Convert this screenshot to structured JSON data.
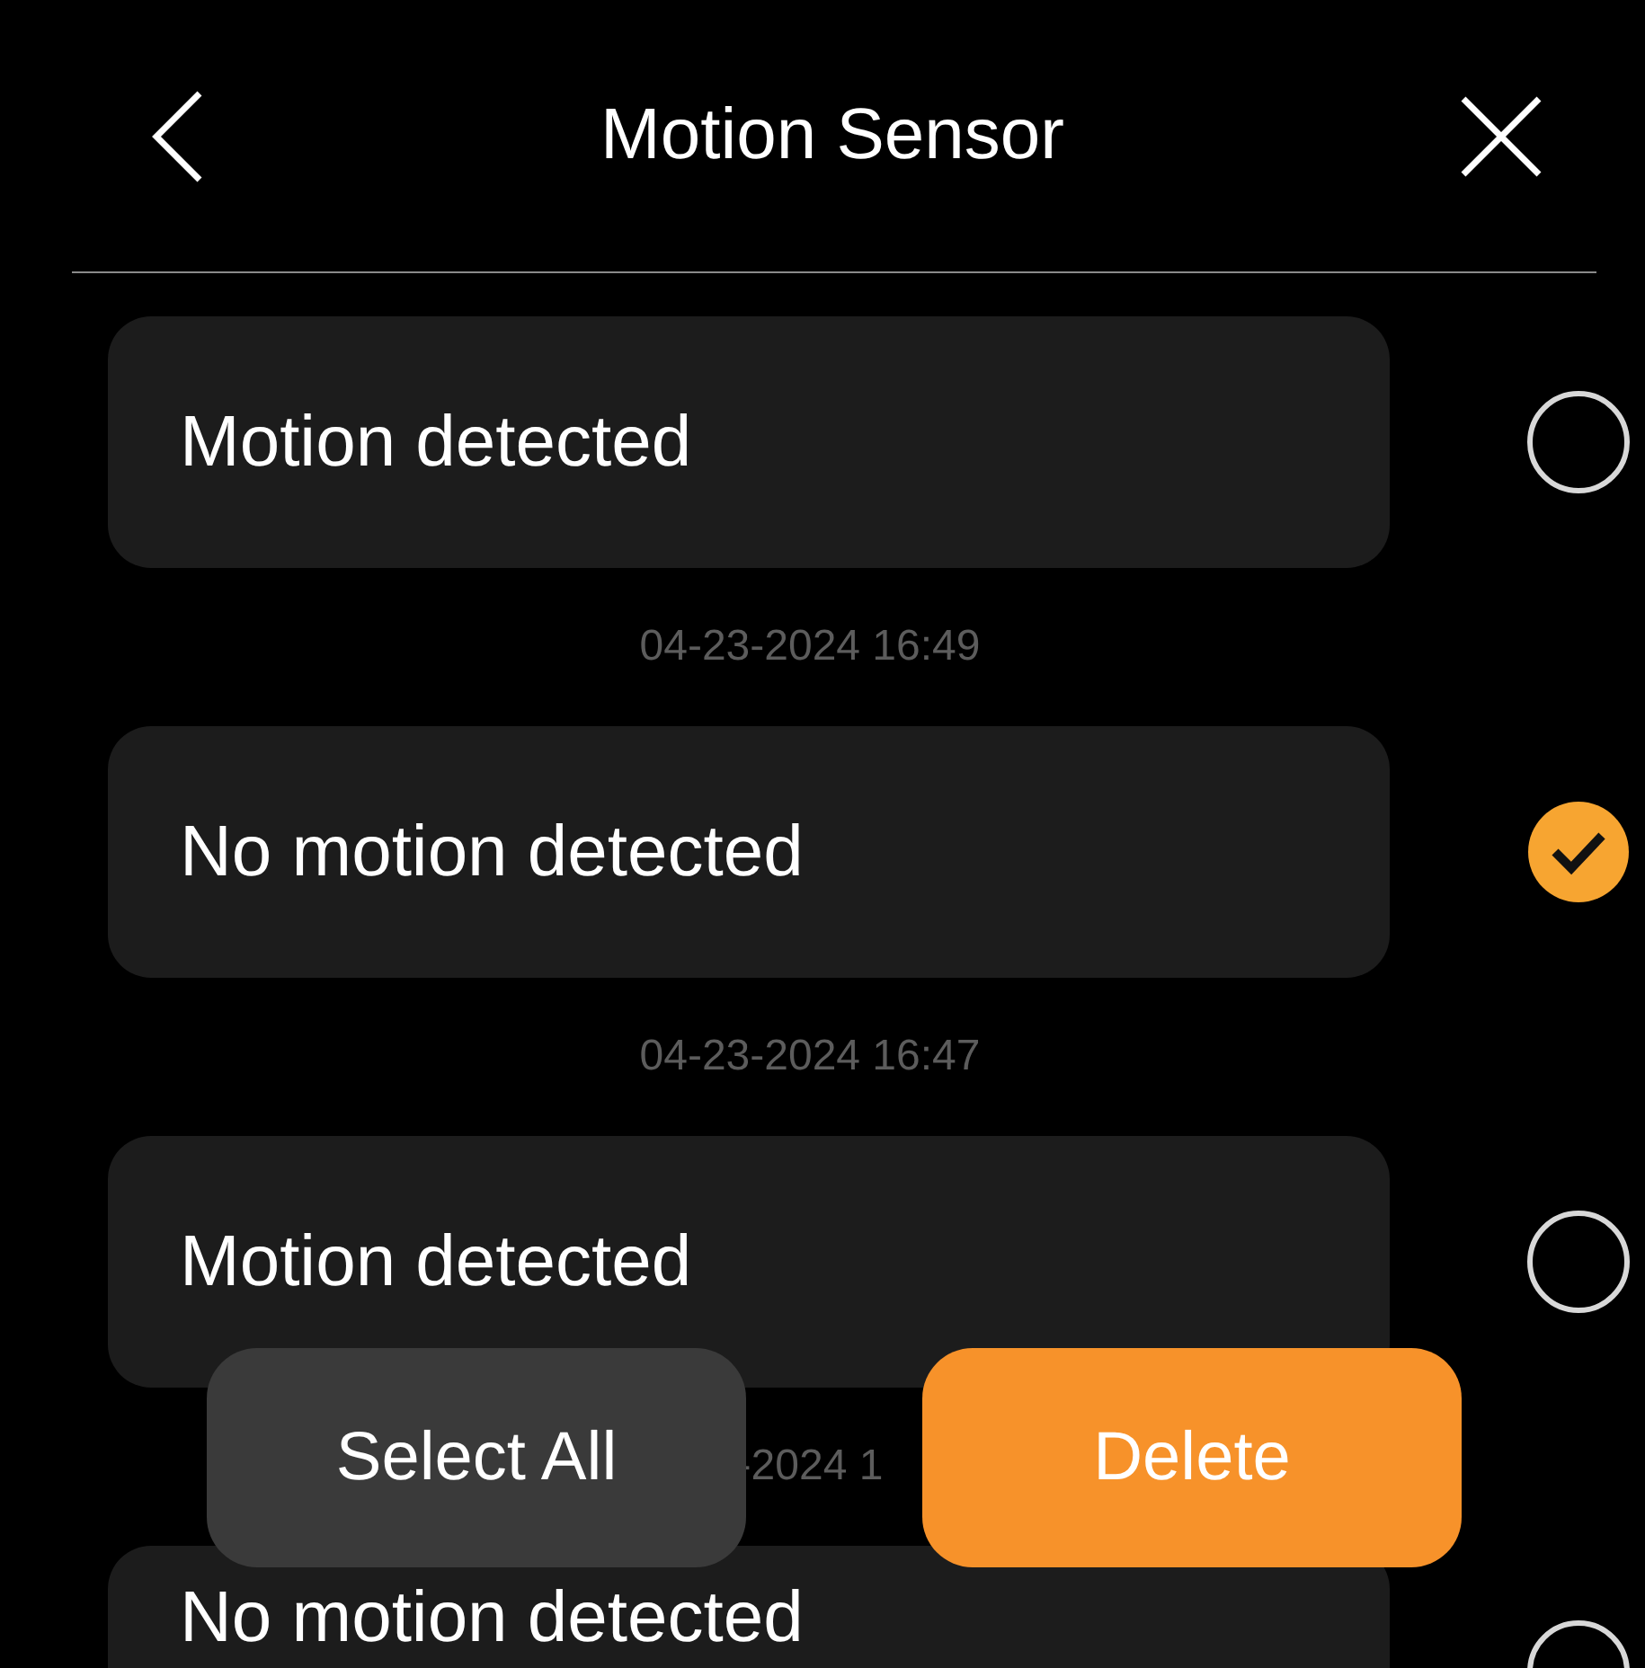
{
  "header": {
    "title": "Motion Sensor"
  },
  "events": [
    {
      "text": "Motion detected",
      "selected": false,
      "timestamp": "04-23-2024 16:49"
    },
    {
      "text": "No motion detected",
      "selected": true,
      "timestamp": "04-23-2024 16:47"
    },
    {
      "text": "Motion detected",
      "selected": false,
      "timestamp": "-2024 1"
    },
    {
      "text": "No motion detected",
      "selected": false
    }
  ],
  "actions": [
    {
      "label": "Select All",
      "kind": "secondary"
    },
    {
      "label": "Delete",
      "kind": "primary"
    }
  ]
}
